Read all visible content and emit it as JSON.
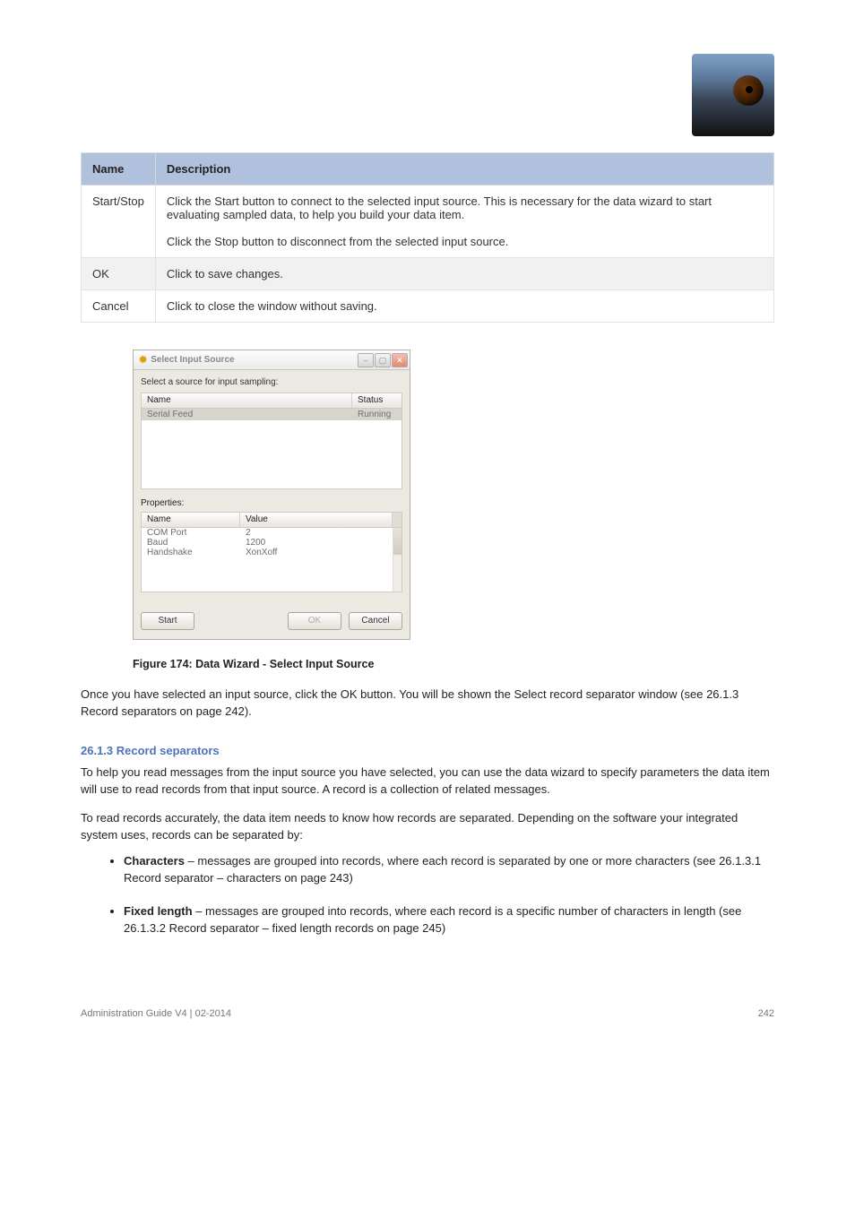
{
  "meta_table": {
    "headers": [
      "Name",
      "Description"
    ],
    "rows": [
      {
        "name": "Start/Stop",
        "description": "Click the Start button to connect to the selected input source. This is necessary for the data wizard to start evaluating sampled data, to help you build your data item.\n\nClick the Stop button to disconnect from the selected input source."
      },
      {
        "name": "OK",
        "description": "Click to save changes."
      },
      {
        "name": "Cancel",
        "description": "Click to close the window without saving."
      }
    ]
  },
  "dialog": {
    "title": "Select Input Source",
    "instruction": "Select a source for input sampling:",
    "source_header_name": "Name",
    "source_header_status": "Status",
    "source_row_name": "Serial Feed",
    "source_row_status": "Running",
    "properties_label": "Properties:",
    "prop_header_name": "Name",
    "prop_header_value": "Value",
    "prop_rows": [
      {
        "name": "COM Port",
        "value": "2"
      },
      {
        "name": "Baud",
        "value": "1200"
      },
      {
        "name": "Handshake",
        "value": "XonXoff"
      }
    ],
    "buttons": {
      "start": "Start",
      "ok": "OK",
      "cancel": "Cancel"
    }
  },
  "figure_caption": "Figure 174:  Data Wizard - Select Input Source",
  "paragraphs": {
    "p1": "Once you have selected an input source, click the OK button. You will be shown the Select record separator window (see 26.1.3 Record separators on page 242)."
  },
  "sections": {
    "record_separators_title": "26.1.3 Record separators",
    "record_separators_intro": "To help you read messages from the input source you have selected, you can use the data wizard to specify parameters the data item will use to read records from that input source. A record is a collection of related messages.",
    "record_separators_line2": "To read records accurately, the data item needs to know how records are separated. Depending on the software your integrated system uses, records can be separated by:",
    "bullets": [
      {
        "lead": "Characters",
        "rest": " – messages are grouped into records, where each record is separated by one or more characters (see 26.1.3.1 Record separator – characters on page 243)"
      },
      {
        "lead": "Fixed length",
        "rest": " – messages are grouped into records, where each record is a specific number of characters in length (see 26.1.3.2 Record separator – fixed length records on page 245)"
      }
    ]
  },
  "footer": {
    "left": "Administration Guide V4  |  02-2014",
    "right": "242"
  }
}
